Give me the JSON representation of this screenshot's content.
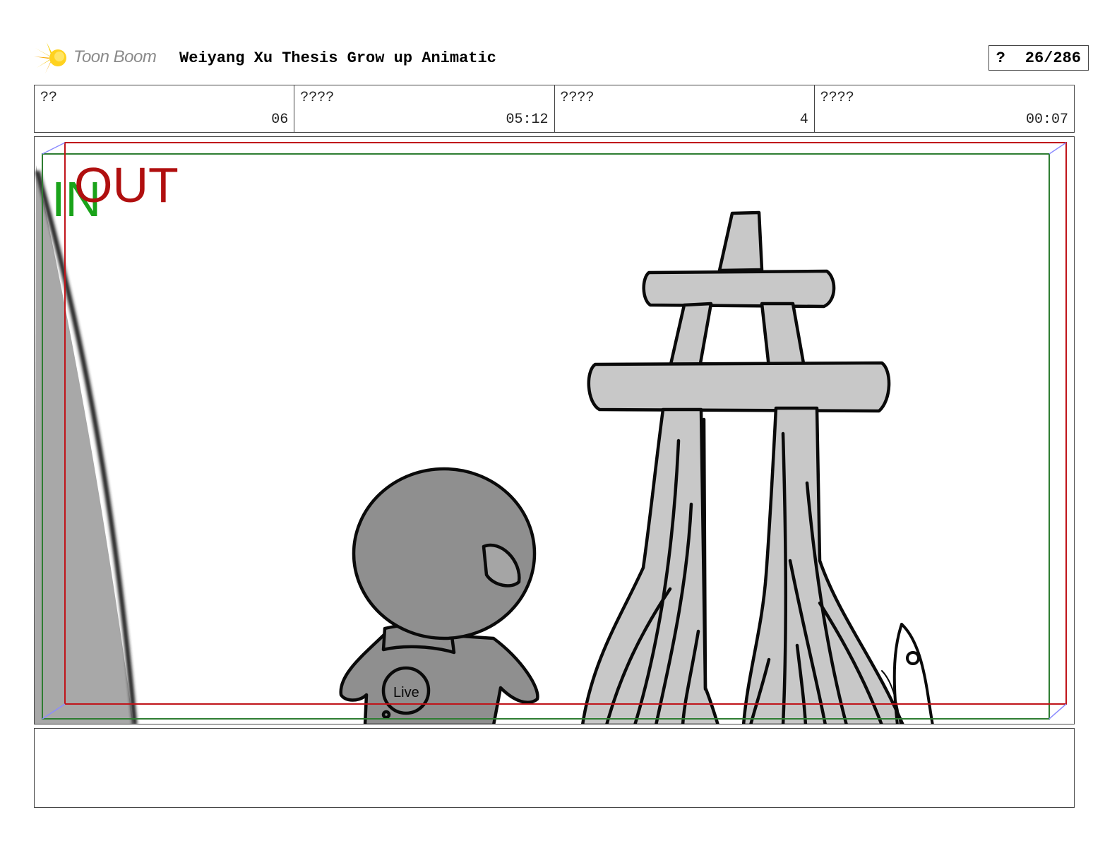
{
  "header": {
    "logo_text": "Toon Boom",
    "title": "Weiyang Xu Thesis Grow up Animatic",
    "page_label": "?",
    "page_number": "26/286"
  },
  "info": [
    {
      "label": "??",
      "value": "06"
    },
    {
      "label": "????",
      "value": "05:12"
    },
    {
      "label": "????",
      "value": "4"
    },
    {
      "label": "????",
      "value": "00:07"
    }
  ],
  "panel": {
    "in_label": "IN",
    "out_label": "OUT",
    "patch_text": "Live",
    "colors": {
      "in": "#1aa31a",
      "out": "#b00f0f",
      "green_frame": "#2e7d32",
      "red_frame": "#c0141a"
    }
  },
  "notes": {
    "text": ""
  }
}
